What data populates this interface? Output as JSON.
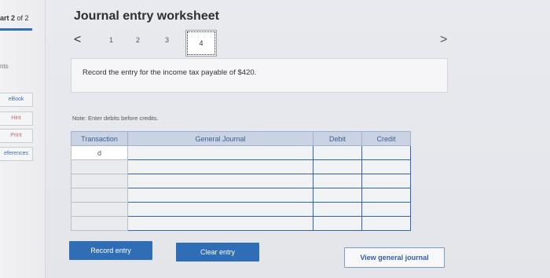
{
  "sidebar": {
    "part_label": "art 2",
    "part_of": "of 2",
    "points_label": "nts",
    "buttons": {
      "ebook": "eBook",
      "hint": "Hint",
      "print": "Print",
      "references": "eferences"
    }
  },
  "header": {
    "title": "Journal entry worksheet"
  },
  "pager": {
    "prev": "<",
    "next": ">",
    "pages": [
      "1",
      "2",
      "3",
      "4"
    ],
    "current": "4"
  },
  "instruction": "Record the entry for the income tax payable of $420.",
  "note": "Note: Enter debits before credits.",
  "table": {
    "headers": [
      "Transaction",
      "General Journal",
      "Debit",
      "Credit"
    ],
    "rows": [
      [
        "d",
        "",
        "",
        ""
      ],
      [
        "",
        "",
        "",
        ""
      ],
      [
        "",
        "",
        "",
        ""
      ],
      [
        "",
        "",
        "",
        ""
      ],
      [
        "",
        "",
        "",
        ""
      ],
      [
        "",
        "",
        "",
        ""
      ]
    ]
  },
  "actions": {
    "record": "Record entry",
    "clear": "Clear entry",
    "view": "View general journal"
  },
  "colors": {
    "accent": "#2f6db6",
    "table_header": "#c9d3e4",
    "background": "#e9ebef"
  }
}
